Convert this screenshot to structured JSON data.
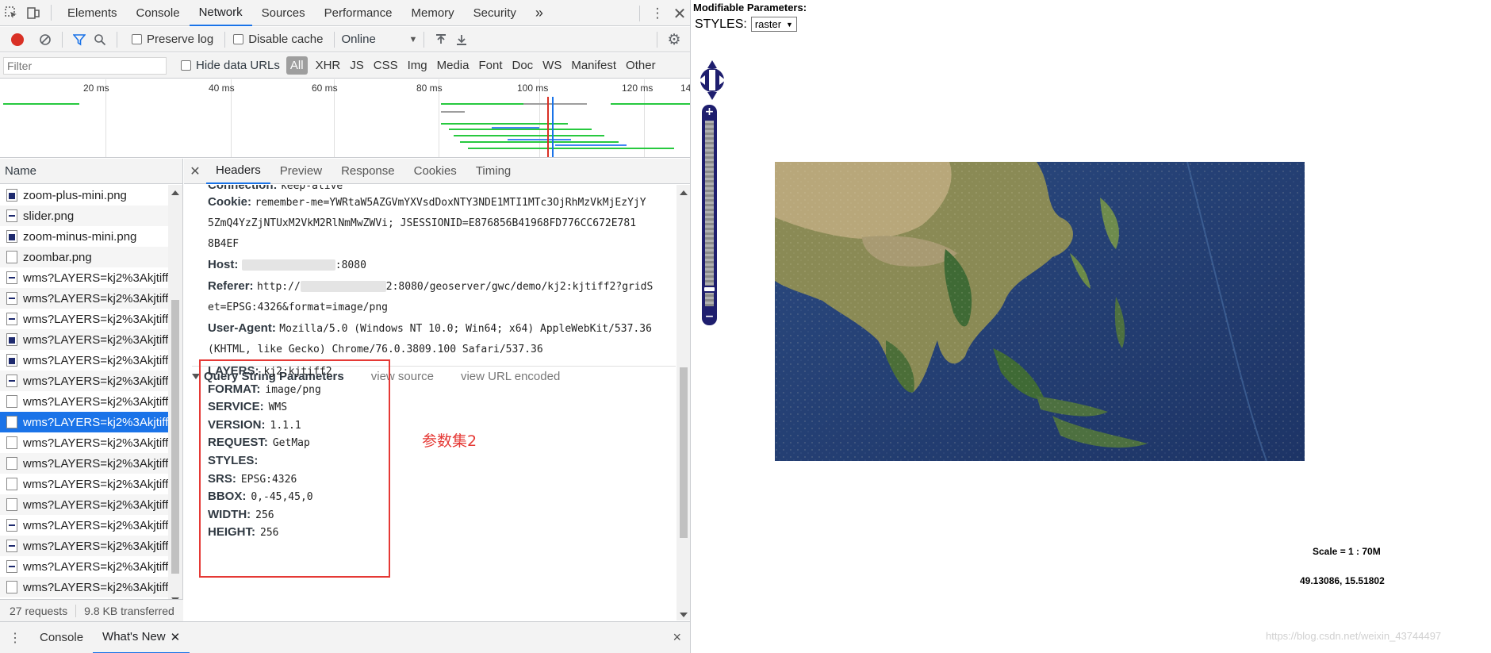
{
  "devtools": {
    "panels": [
      "Elements",
      "Console",
      "Network",
      "Sources",
      "Performance",
      "Memory",
      "Security"
    ],
    "more": "»",
    "toolbar": {
      "preserve_log": "Preserve log",
      "disable_cache": "Disable cache",
      "throttle": "Online"
    },
    "filter": {
      "placeholder": "Filter",
      "hide_data_urls": "Hide data URLs",
      "types": [
        "All",
        "XHR",
        "JS",
        "CSS",
        "Img",
        "Media",
        "Font",
        "Doc",
        "WS",
        "Manifest",
        "Other"
      ]
    },
    "overview_ticks": [
      "20 ms",
      "40 ms",
      "60 ms",
      "80 ms",
      "100 ms",
      "120 ms",
      "14"
    ],
    "name_header": "Name",
    "requests": [
      {
        "name": "zoom-plus-mini.png",
        "icon": "dark"
      },
      {
        "name": "slider.png",
        "icon": "line"
      },
      {
        "name": "zoom-minus-mini.png",
        "icon": "dark"
      },
      {
        "name": "zoombar.png",
        "icon": "plain"
      },
      {
        "name": "wms?LAYERS=kj2%3Akjtiff2",
        "icon": "line"
      },
      {
        "name": "wms?LAYERS=kj2%3Akjtiff2",
        "icon": "line"
      },
      {
        "name": "wms?LAYERS=kj2%3Akjtiff2",
        "icon": "line"
      },
      {
        "name": "wms?LAYERS=kj2%3Akjtiff2",
        "icon": "dark"
      },
      {
        "name": "wms?LAYERS=kj2%3Akjtiff2",
        "icon": "dark"
      },
      {
        "name": "wms?LAYERS=kj2%3Akjtiff2",
        "icon": "line"
      },
      {
        "name": "wms?LAYERS=kj2%3Akjtiff2",
        "icon": "plain"
      },
      {
        "name": "wms?LAYERS=kj2%3Akjtiff2",
        "icon": "plain",
        "selected": true
      },
      {
        "name": "wms?LAYERS=kj2%3Akjtiff2",
        "icon": "plain"
      },
      {
        "name": "wms?LAYERS=kj2%3Akjtiff2",
        "icon": "plain"
      },
      {
        "name": "wms?LAYERS=kj2%3Akjtiff2",
        "icon": "plain"
      },
      {
        "name": "wms?LAYERS=kj2%3Akjtiff2",
        "icon": "plain"
      },
      {
        "name": "wms?LAYERS=kj2%3Akjtiff2",
        "icon": "line"
      },
      {
        "name": "wms?LAYERS=kj2%3Akjtiff2",
        "icon": "line"
      },
      {
        "name": "wms?LAYERS=kj2%3Akjtiff2",
        "icon": "line"
      },
      {
        "name": "wms?LAYERS=kj2%3Akjtiff2",
        "icon": "plain"
      }
    ],
    "status": {
      "requests": "27 requests",
      "transferred": "9.8 KB transferred"
    },
    "detail_tabs": [
      "Headers",
      "Preview",
      "Response",
      "Cookies",
      "Timing"
    ],
    "headers": {
      "connection_key": "Connection:",
      "connection_val": "keep-alive",
      "cookie_key": "Cookie:",
      "cookie_val_1": "remember-me=YWRtaW5AZGVmYXVsdDoxNTY3NDE1MTI1MTc3OjRhMzVkMjEzYjY",
      "cookie_val_2": "5ZmQ4YzZjNTUxM2VkM2RlNmMwZWVi; JSESSIONID=E876856B41968FD776CC672E781",
      "cookie_val_3": "8B4EF",
      "host_key": "Host:",
      "host_suffix": ":8080",
      "referer_key": "Referer:",
      "referer_prefix": "http://",
      "referer_suffix": "2:8080/geoserver/gwc/demo/kj2:kjtiff2?gridS",
      "referer_val_2": "et=EPSG:4326&format=image/png",
      "ua_key": "User-Agent:",
      "ua_val_1": "Mozilla/5.0 (Windows NT 10.0; Win64; x64) AppleWebKit/537.36",
      "ua_val_2": "(KHTML, like Gecko) Chrome/76.0.3809.100 Safari/537.36"
    },
    "query": {
      "title": "Query String Parameters",
      "view_source": "view source",
      "view_url_encoded": "view URL encoded",
      "params": [
        {
          "key": "LAYERS:",
          "value": "kj2:kjtiff2"
        },
        {
          "key": "FORMAT:",
          "value": "image/png"
        },
        {
          "key": "SERVICE:",
          "value": "WMS"
        },
        {
          "key": "VERSION:",
          "value": "1.1.1"
        },
        {
          "key": "REQUEST:",
          "value": "GetMap"
        },
        {
          "key": "STYLES:",
          "value": ""
        },
        {
          "key": "SRS:",
          "value": "EPSG:4326"
        },
        {
          "key": "BBOX:",
          "value": "0,-45,45,0"
        },
        {
          "key": "WIDTH:",
          "value": "256"
        },
        {
          "key": "HEIGHT:",
          "value": "256"
        }
      ]
    },
    "annotation": "参数集2",
    "drawer": {
      "console": "Console",
      "whats_new": "What's New",
      "close": "×"
    }
  },
  "map_page": {
    "title": "Modifiable Parameters:",
    "styles_label": "STYLES:",
    "styles_value": "raster",
    "scale": "Scale = 1 : 70M",
    "coords": "49.13086, 15.51802",
    "watermark": "https://blog.csdn.net/weixin_43744497"
  },
  "colors": {
    "accent": "#1a73e8",
    "record": "#d93025",
    "annotation": "#e53935",
    "map_control": "#1e1e6e"
  }
}
